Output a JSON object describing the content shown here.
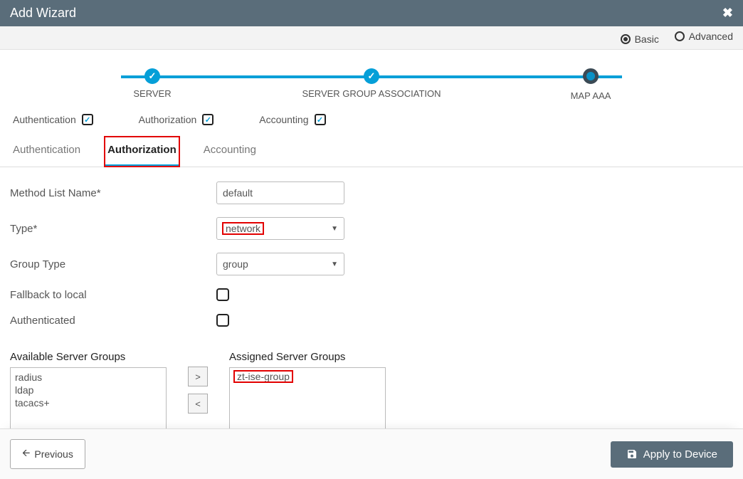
{
  "header": {
    "title": "Add Wizard"
  },
  "mode": {
    "basic": "Basic",
    "advanced": "Advanced",
    "selected": "basic"
  },
  "wizard": {
    "steps": [
      {
        "label": "SERVER",
        "state": "done"
      },
      {
        "label": "SERVER GROUP ASSOCIATION",
        "state": "done"
      },
      {
        "label": "MAP AAA",
        "state": "current"
      }
    ]
  },
  "mapaaa_flags": {
    "authentication": {
      "label": "Authentication",
      "checked": true
    },
    "authorization": {
      "label": "Authorization",
      "checked": true
    },
    "accounting": {
      "label": "Accounting",
      "checked": true
    }
  },
  "tabs": {
    "authentication": "Authentication",
    "authorization": "Authorization",
    "accounting": "Accounting",
    "active": "authorization"
  },
  "form": {
    "method_list_name": {
      "label": "Method List Name*",
      "value": "default"
    },
    "type": {
      "label": "Type*",
      "value": "network"
    },
    "group_type": {
      "label": "Group Type",
      "value": "group"
    },
    "fallback": {
      "label": "Fallback to local",
      "checked": false
    },
    "authenticated": {
      "label": "Authenticated",
      "checked": false
    }
  },
  "server_groups": {
    "available_label": "Available Server Groups",
    "assigned_label": "Assigned Server Groups",
    "available": [
      "radius",
      "ldap",
      "tacacs+"
    ],
    "assigned": [
      "zt-ise-group"
    ]
  },
  "footer": {
    "previous": "Previous",
    "apply": "Apply to Device"
  }
}
